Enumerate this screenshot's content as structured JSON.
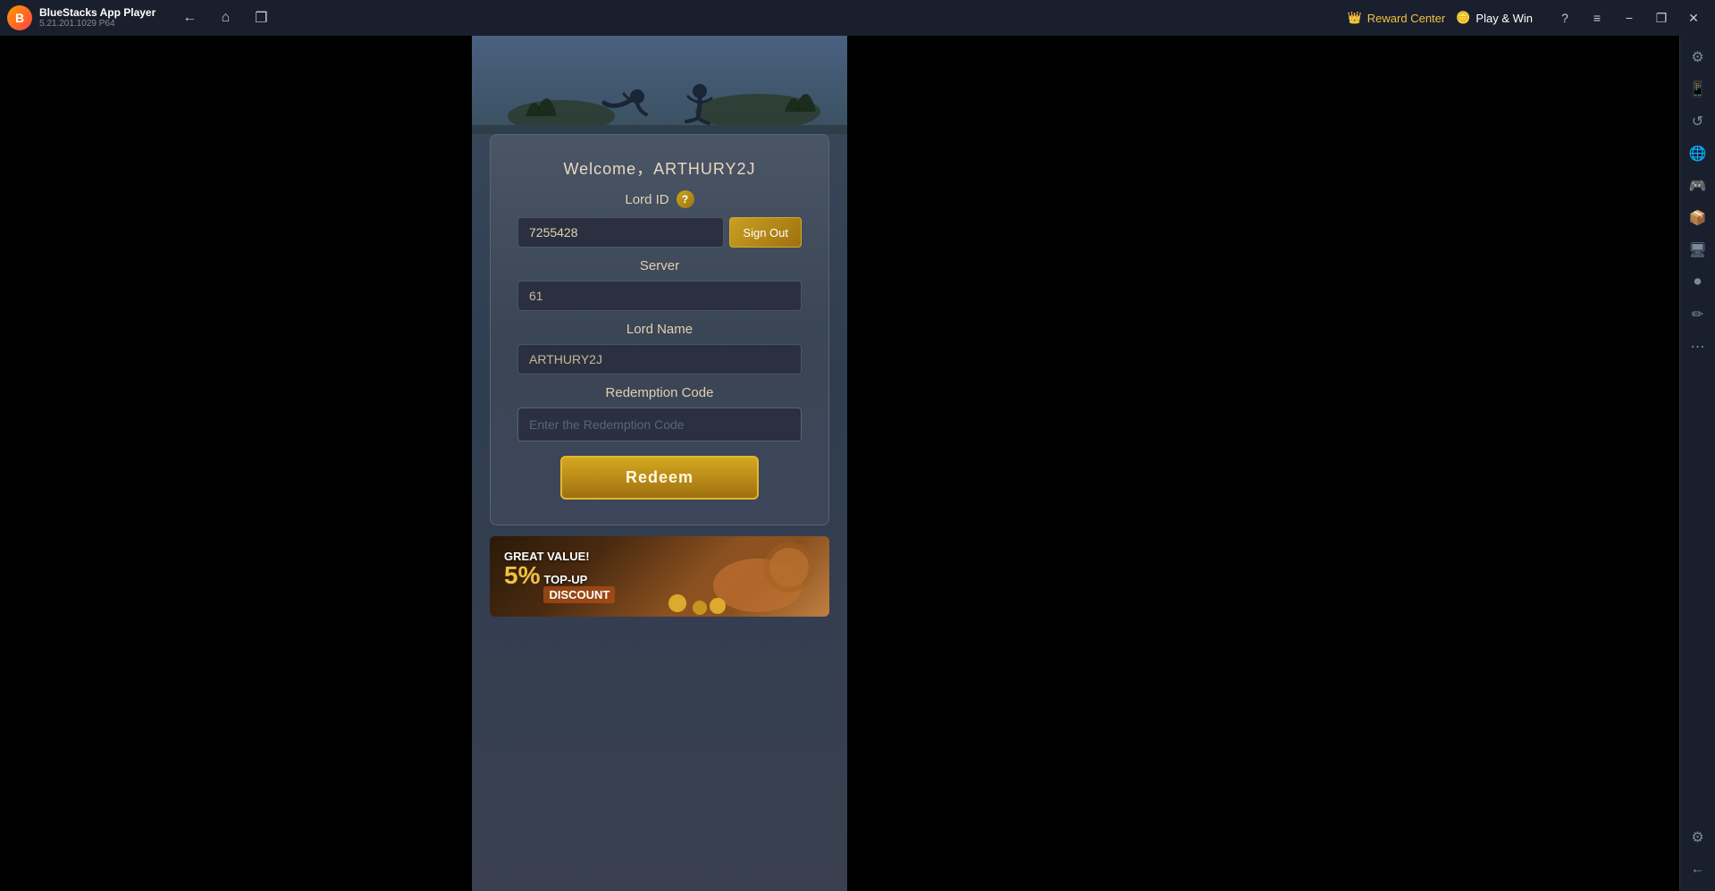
{
  "titleBar": {
    "appName": "BlueStacks App Player",
    "appVersion": "5.21.201.1029  P64",
    "rewardCenter": "Reward Center",
    "playWin": "Play & Win",
    "backIcon": "←",
    "homeIcon": "⌂",
    "multiIcon": "❐",
    "minimizeIcon": "−",
    "restoreIcon": "❐",
    "closeIcon": "✕",
    "questionIcon": "?",
    "menuIcon": "≡"
  },
  "game": {
    "welcomeText": "Welcome，ARTHURY2J",
    "lordIdLabel": "Lord ID",
    "lordIdValue": "7255428",
    "signOutLabel": "Sign Out",
    "serverLabel": "Server",
    "serverValue": "61",
    "lordNameLabel": "Lord Name",
    "lordNameValue": "ARTHURY2J",
    "redemptionCodeLabel": "Redemption Code",
    "redemptionCodePlaceholder": "Enter the Redemption Code",
    "redeemLabel": "Redeem"
  },
  "banner": {
    "greatValue": "GREAT",
    "valueText": "VALUE!",
    "percent": "5%",
    "topUpText": "TOP-UP",
    "discountText": "DISCOUNT"
  },
  "sidebar": {
    "icons": [
      "⚙",
      "📱",
      "↺",
      "🌐",
      "🎮",
      "📦",
      "🖥",
      "✏",
      "⋯",
      "⚙",
      "←"
    ]
  }
}
